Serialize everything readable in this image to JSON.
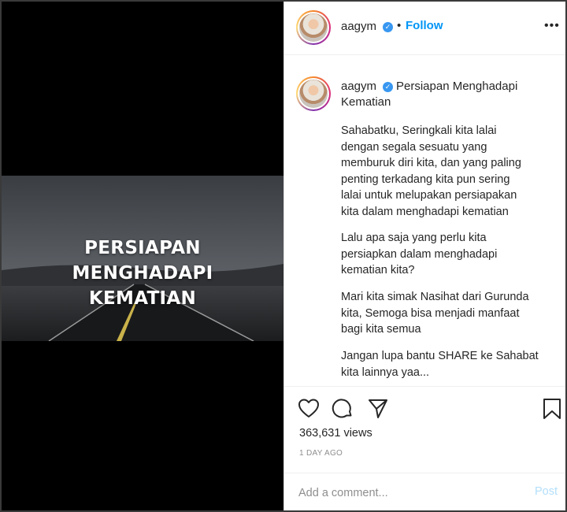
{
  "media": {
    "title_lines": [
      "PERSIAPAN",
      "MENGHADAPI",
      "KEMATIAN"
    ]
  },
  "header": {
    "username": "aagym",
    "verified_icon": "verified-badge-icon",
    "separator": "•",
    "follow_label": "Follow",
    "more_label": "•••"
  },
  "caption": {
    "username": "aagym",
    "title_line1": "Persiapan Menghadapi",
    "title_line2": "Kematian",
    "paragraphs": [
      "Sahabatku, Seringkali kita lalai\ndengan segala sesuatu yang\nmemburuk diri kita, dan yang paling\npenting terkadang kita pun sering\nlalai untuk melupakan persiapakan\nkita dalam menghadapi kematian",
      "Lalu apa saja yang perlu kita\npersiapkan dalam menghadapi\nkematian kita?",
      "Mari kita simak Nasihat dari Gurunda\nkita, Semoga bisa menjadi manfaat\nbagi kita semua",
      "Jangan lupa bantu SHARE ke Sahabat\nkita lainnya yaa..."
    ]
  },
  "actions": {
    "icons": [
      "heart-icon",
      "comment-icon",
      "share-icon",
      "bookmark-icon"
    ],
    "views": "363,631 views",
    "date": "1 DAY AGO"
  },
  "comment": {
    "placeholder": "Add a comment...",
    "post_label": "Post"
  },
  "colors": {
    "accent": "#0095f6",
    "post_disabled": "#b2dffc",
    "muted": "#8e8e8e",
    "media_bg": "#000000"
  }
}
